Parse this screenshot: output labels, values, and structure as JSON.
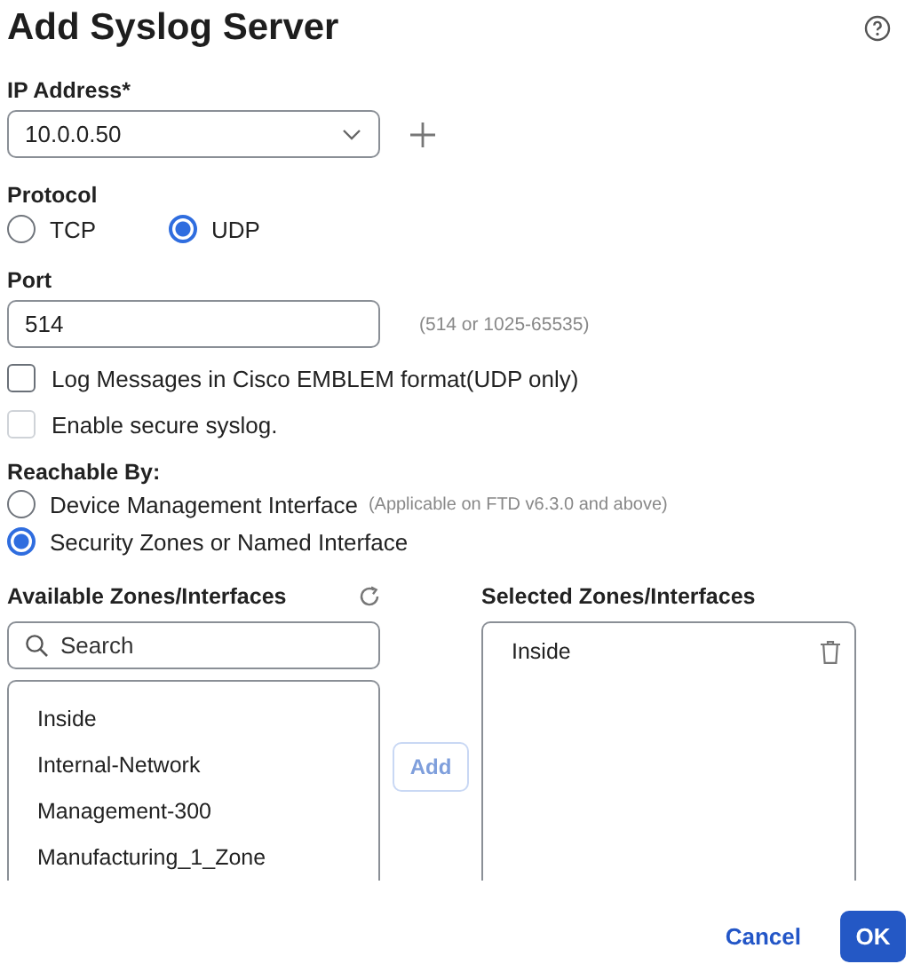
{
  "dialog": {
    "title": "Add Syslog Server"
  },
  "ip_address": {
    "label": "IP Address*",
    "value": "10.0.0.50"
  },
  "protocol": {
    "label": "Protocol",
    "options": [
      {
        "label": "TCP",
        "selected": false
      },
      {
        "label": "UDP",
        "selected": true
      }
    ]
  },
  "port": {
    "label": "Port",
    "value": "514",
    "hint": "(514 or 1025-65535)"
  },
  "checkboxes": [
    {
      "label": "Log Messages in Cisco EMBLEM format(UDP only)",
      "checked": false,
      "disabled": false
    },
    {
      "label": "Enable secure syslog.",
      "checked": false,
      "disabled": true
    }
  ],
  "reachable_by": {
    "label": "Reachable By:",
    "options": [
      {
        "label": "Device Management Interface",
        "note": "(Applicable on FTD v6.3.0 and above)",
        "selected": false
      },
      {
        "label": "Security Zones or Named Interface",
        "selected": true
      }
    ]
  },
  "available": {
    "title": "Available Zones/Interfaces",
    "search_placeholder": "Search",
    "items": [
      "Inside",
      "Internal-Network",
      "Management-300",
      "Manufacturing_1_Zone"
    ]
  },
  "add_button": {
    "label": "Add",
    "disabled": true
  },
  "selected": {
    "title": "Selected Zones/Interfaces",
    "items": [
      "Inside"
    ]
  },
  "buttons": [
    {
      "label": "Cancel",
      "kind": "link"
    },
    {
      "label": "OK",
      "kind": "primary"
    }
  ]
}
